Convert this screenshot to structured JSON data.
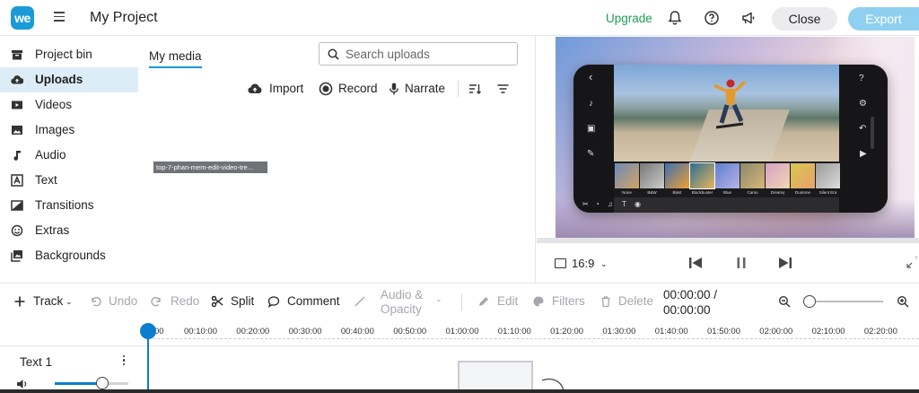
{
  "header": {
    "logo_text": "we",
    "project_title": "My Project",
    "upgrade_label": "Upgrade",
    "close_label": "Close",
    "export_label": "Export",
    "icons": [
      "hamburger-icon",
      "bell-icon",
      "help-icon",
      "megaphone-icon"
    ]
  },
  "sidebar": {
    "items": [
      {
        "label": "Project bin",
        "icon": "archive-icon"
      },
      {
        "label": "Uploads",
        "icon": "cloud-upload-icon",
        "active": true
      },
      {
        "label": "Videos",
        "icon": "video-icon"
      },
      {
        "label": "Images",
        "icon": "image-icon"
      },
      {
        "label": "Audio",
        "icon": "music-note-icon"
      },
      {
        "label": "Text",
        "icon": "text-icon"
      },
      {
        "label": "Transitions",
        "icon": "transition-icon"
      },
      {
        "label": "Extras",
        "icon": "smiley-icon"
      },
      {
        "label": "Backgrounds",
        "icon": "backgrounds-icon"
      }
    ]
  },
  "media": {
    "tab_label": "My media",
    "search_placeholder": "Search uploads",
    "actions": {
      "import": "Import",
      "record": "Record",
      "narrate": "Narrate"
    },
    "uploaded_file_name": "top-7-phan-mem-edit-video-tre..."
  },
  "preview": {
    "aspect_ratio": "16:9",
    "filter_names": [
      "None",
      "B&W",
      "Blast",
      "Blockbuster",
      "Blue",
      "Camo",
      "Dreamy",
      "Duotone",
      "Silent Era",
      "Vintage"
    ],
    "progress": 0
  },
  "timeline_toolbar": {
    "track": "Track",
    "undo": "Undo",
    "redo": "Redo",
    "split": "Split",
    "comment": "Comment",
    "audio_opacity_line1": "Audio &",
    "audio_opacity_line2": "Opacity",
    "edit": "Edit",
    "filters": "Filters",
    "delete": "Delete",
    "current_time": "00:00:00 /",
    "total_time": "00:00:00"
  },
  "ruler": {
    "ticks": [
      "00",
      "00:10:00",
      "00:20:00",
      "00:30:00",
      "00:40:00",
      "00:50:00",
      "01:00:00",
      "01:10:00",
      "01:20:00",
      "01:30:00",
      "01:40:00",
      "01:50:00",
      "02:00:00",
      "02:10:00",
      "02:20:00"
    ]
  },
  "track": {
    "name": "Text 1",
    "volume": 0.65
  },
  "colors": {
    "accent": "#1b9ad8",
    "upgrade": "#1f9d57",
    "export_bg": "#8fd0f0",
    "active_bg": "#dcedf8",
    "playhead": "#0d7dcd"
  }
}
